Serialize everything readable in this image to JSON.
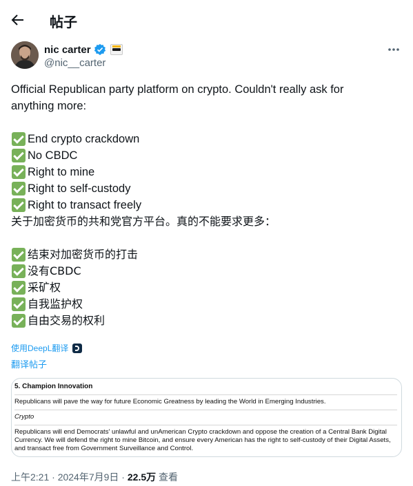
{
  "header": {
    "title": "帖子"
  },
  "author": {
    "name": "nic carter",
    "handle": "@nic__carter"
  },
  "tweet": {
    "intro": [
      "Official Republican party platform on crypto. Couldn't really ask for",
      "anything more:"
    ],
    "points": [
      "End crypto crackdown",
      "No CBDC",
      "Right to mine",
      "Right to self-custody",
      "Right to transact freely"
    ],
    "intro_zh": "关于加密货币的共和党官方平台。真的不能要求更多：",
    "points_zh": [
      "结束对加密货币的打击",
      "没有CBDC",
      "采矿权",
      "自我监护权",
      "自由交易的权利"
    ]
  },
  "translation": {
    "deepl_label": "使用DeepL翻译",
    "translate_post": "翻译帖子"
  },
  "card": {
    "heading": "5. Champion Innovation",
    "para1": "Republicans will pave the way for future Economic Greatness by leading the World in Emerging Industries.",
    "subhead": "Crypto",
    "para2": "Republicans will end Democrats' unlawful and unAmerican Crypto crackdown and oppose the creation of a Central Bank Digital Currency. We will defend the right to mine Bitcoin, and ensure every American has the right to self-custody of their Digital Assets, and transact free from Government Surveillance and Control."
  },
  "meta": {
    "time": "上午2:21",
    "date": "2024年7月9日",
    "views": "22.5万",
    "views_label": "查看",
    "sep": " · "
  },
  "colors": {
    "accent": "#1d9bf0",
    "check": "#78b159",
    "muted": "#536471"
  }
}
